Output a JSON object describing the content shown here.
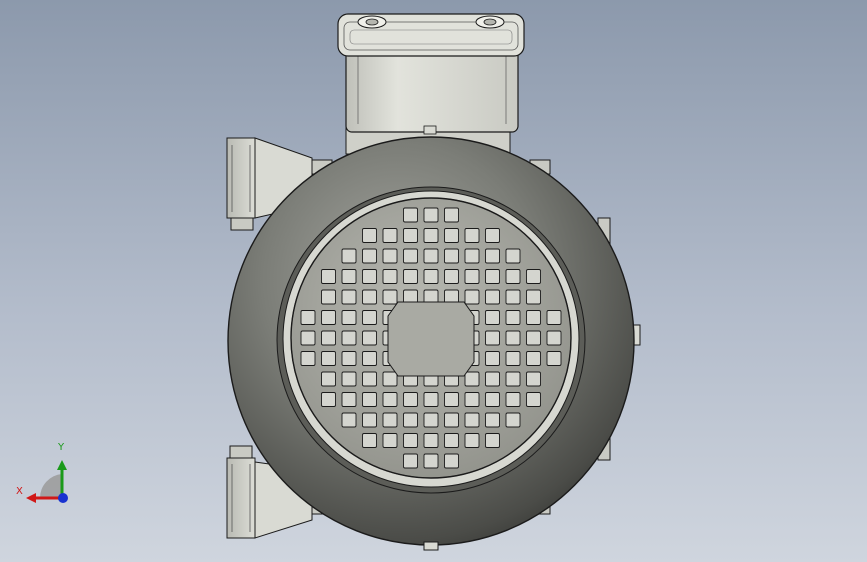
{
  "colors": {
    "background_top": "#8c99ac",
    "background_bottom": "#cfd5de",
    "housing": "#6f716b",
    "housing_dark": "#3c3d39",
    "housing_light": "#a4a59f",
    "grille": "#a9aaa3",
    "grille_slot": "#d4d5cf",
    "terminal_box": "#d6d7d0",
    "outline": "#1b1b1b",
    "axis_x": "#d01818",
    "axis_y": "#1a9a1a",
    "axis_z": "#1832d0"
  },
  "triad": {
    "x_label": "X",
    "y_label": "Y"
  }
}
